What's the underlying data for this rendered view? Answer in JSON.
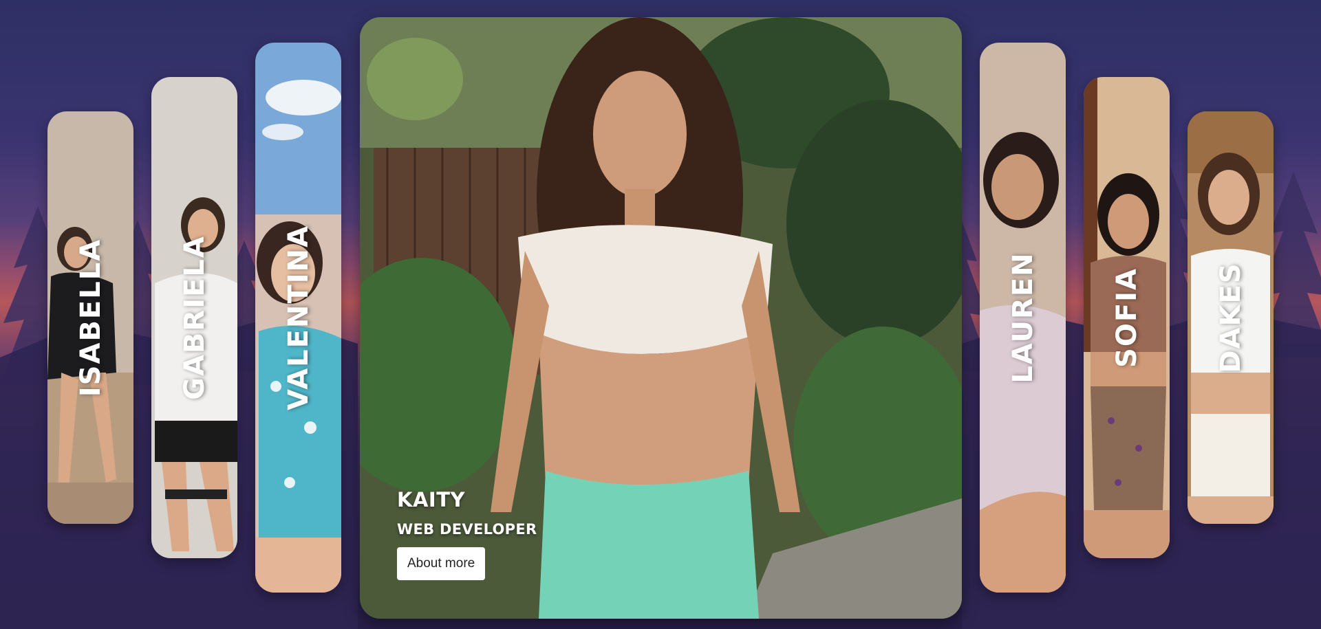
{
  "side_cards": [
    {
      "name": "ISABELLA"
    },
    {
      "name": "GABRIELA"
    },
    {
      "name": "VALENTINA"
    },
    {
      "name": "LAUREN"
    },
    {
      "name": "SOFIA"
    },
    {
      "name": "DAKES"
    }
  ],
  "featured": {
    "name": "KAITY",
    "role": "WEB DEVELOPER",
    "button_label": "About more"
  },
  "colors": {
    "background_top": "#2e2f64",
    "background_glow": "#b6575c",
    "background_bottom": "#281f4a",
    "button_bg": "#ffffff",
    "text": "#ffffff"
  }
}
